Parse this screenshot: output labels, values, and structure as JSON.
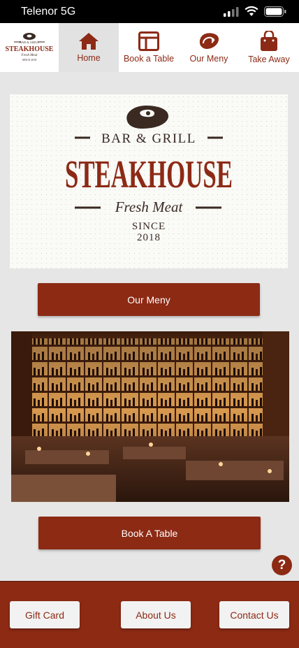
{
  "statusbar": {
    "carrier": "Telenor 5G"
  },
  "colors": {
    "accent": "#8c2a14",
    "background": "#e6e6e6",
    "footer": "#8c2a14"
  },
  "nav": {
    "logo_text": {
      "top": "BAR & GRILL",
      "main": "STEAKHOUSE",
      "sub": "Fresh Meat",
      "since": "SINCE 2018"
    },
    "items": [
      {
        "label": "Home",
        "icon": "home-icon",
        "active": true
      },
      {
        "label": "Book a Table",
        "icon": "table-layout-icon",
        "active": false
      },
      {
        "label": "Our Meny",
        "icon": "steak-icon",
        "active": false
      },
      {
        "label": "Take Away",
        "icon": "shopping-bag-icon",
        "active": false
      }
    ]
  },
  "hero": {
    "top": "BAR & GRILL",
    "main": "STEAKHOUSE",
    "sub": "Fresh Meat",
    "since": "SINCE",
    "year": "2018"
  },
  "buttons": {
    "our_meny": "Our Meny",
    "book_table": "Book A Table",
    "help": "?"
  },
  "footer": {
    "gift_card": "Gift Card",
    "about_us": "About Us",
    "contact_us": "Contact Us"
  }
}
